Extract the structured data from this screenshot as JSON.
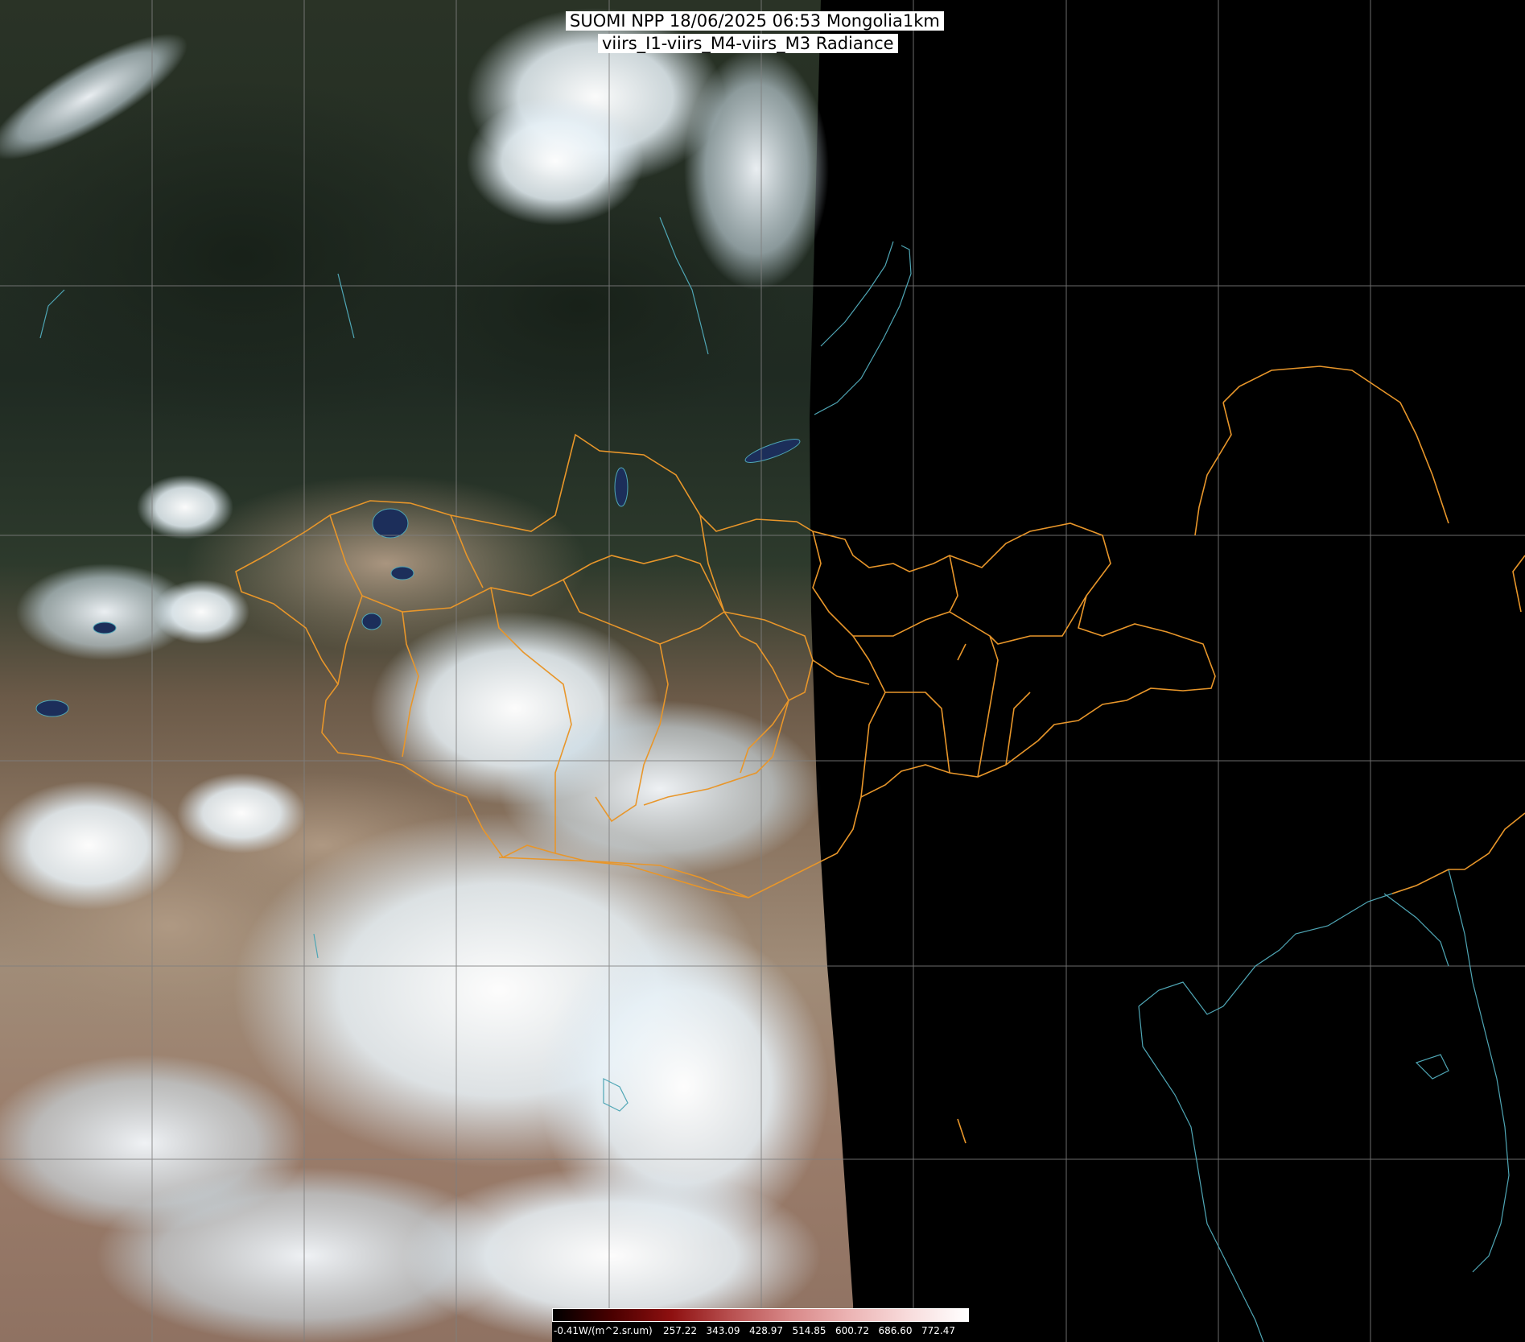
{
  "title": {
    "line1": "SUOMI NPP 18/06/2025 06:53 Mongolia1km",
    "line2": "viirs_I1-viirs_M4-viirs_M3 Radiance"
  },
  "colors": {
    "country_border": "#e8962a",
    "coastline": "#4fa6b5",
    "graticule": "#7f7f7f",
    "night_side": "#000000"
  },
  "colorbar": {
    "labels": [
      "-0.41W/(m^2.sr.um)",
      "257.22",
      "343.09",
      "428.97",
      "514.85",
      "600.72",
      "686.60",
      "772.47"
    ],
    "gradient_colors": [
      "#000000",
      "#4a0000",
      "#8e1010",
      "#b85050",
      "#d88888",
      "#ecb4b4",
      "#f8dcdc",
      "#ffffff"
    ]
  }
}
